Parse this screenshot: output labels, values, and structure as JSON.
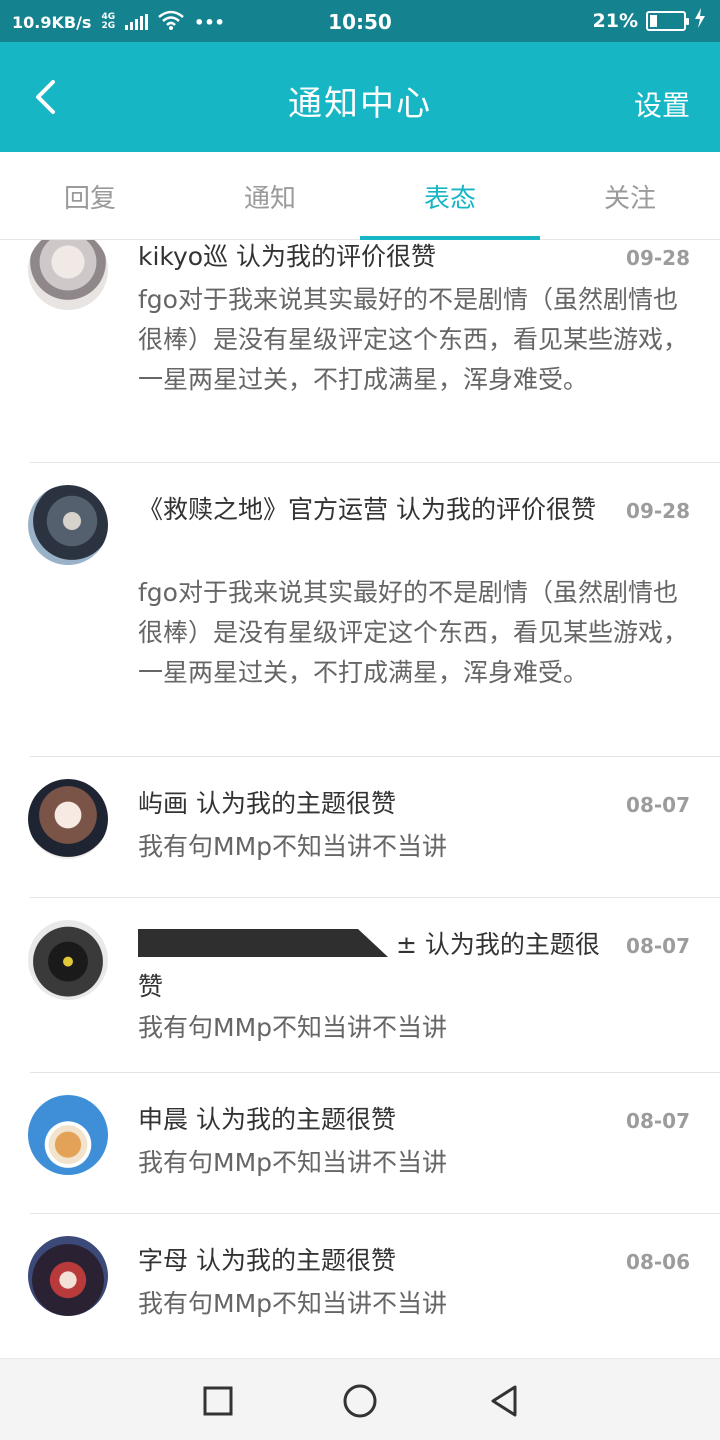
{
  "status_bar": {
    "net_speed": "10.9KB/s",
    "net_type_top": "4G",
    "net_type_bottom": "2G",
    "more": "•••",
    "time": "10:50",
    "battery_percent": "21%",
    "battery_level": 0.21
  },
  "app_bar": {
    "title": "通知中心",
    "settings_label": "设置"
  },
  "tabs": [
    {
      "label": "回复"
    },
    {
      "label": "通知"
    },
    {
      "label": "表态"
    },
    {
      "label": "关注"
    }
  ],
  "notifications": [
    {
      "title": "kikyo巡 认为我的评价很赞",
      "date": "09-28",
      "body": "fgo对于我来说其实最好的不是剧情（虽然剧情也很棒）是没有星级评定这个东西，看见某些游戏，一星两星过关，不打成满星，浑身难受。"
    },
    {
      "title": "《救赎之地》官方运营 认为我的评价很赞",
      "date": "09-28",
      "body": "fgo对于我来说其实最好的不是剧情（虽然剧情也很棒）是没有星级评定这个东西，看见某些游戏，一星两星过关，不打成满星，浑身难受。"
    },
    {
      "title": "屿画 认为我的主题很赞",
      "date": "08-07",
      "body": "我有句MMp不知当讲不当讲"
    },
    {
      "title_suffix": "± 认为我的主题很赞",
      "date": "08-07",
      "body": "我有句MMp不知当讲不当讲"
    },
    {
      "title": "申晨 认为我的主题很赞",
      "date": "08-07",
      "body": "我有句MMp不知当讲不当讲"
    },
    {
      "title": "字母 认为我的主题很赞",
      "date": "08-06",
      "body": "我有句MMp不知当讲不当讲"
    }
  ],
  "colors": {
    "status_bar": "#15838f",
    "app_bar": "#17b6c5",
    "accent": "#17b6c5"
  }
}
